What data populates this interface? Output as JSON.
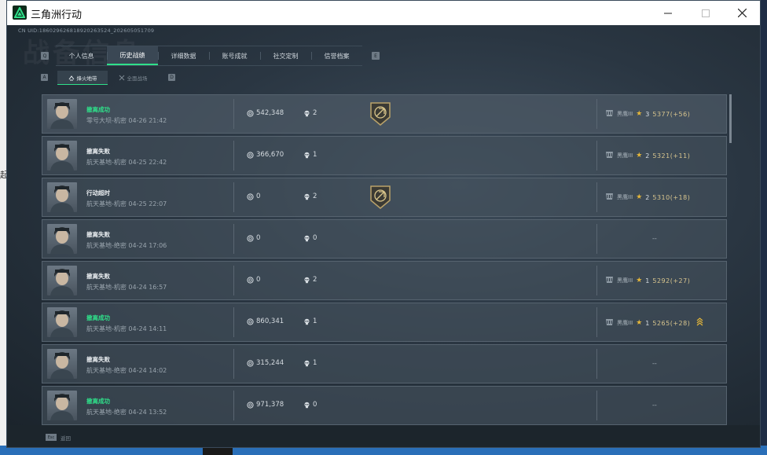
{
  "window": {
    "title": "三角洲行动"
  },
  "header": {
    "uid": "CN UID:18602962681892026352​4_2026050517​09",
    "watermark": "战备信息"
  },
  "tabs": {
    "left_key": "Q",
    "right_key": "E",
    "items": [
      {
        "label": "个人信息",
        "active": false
      },
      {
        "label": "历史战绩",
        "active": true
      },
      {
        "label": "详细数据",
        "active": false
      },
      {
        "label": "账号成就",
        "active": false
      },
      {
        "label": "社交定制",
        "active": false
      },
      {
        "label": "信誉档案",
        "active": false
      }
    ]
  },
  "subtabs": {
    "left_key": "A",
    "right_key": "D",
    "items": [
      {
        "label": "烽火地带",
        "icon": "fire-zone-icon",
        "active": true
      },
      {
        "label": "全面战场",
        "icon": "battlefield-icon",
        "active": false
      }
    ]
  },
  "records": [
    {
      "status": "撤离成功",
      "success": true,
      "mapinfo": "零号大坝-机密 04-26 21:42",
      "coins": "542,348",
      "kills": "2",
      "badge": true,
      "rank": {
        "name": "黑鹰III",
        "stars": "3",
        "score": "5377(+56)"
      },
      "chevron": false
    },
    {
      "status": "撤离失败",
      "success": false,
      "mapinfo": "航天基地-机密 04-25 22:42",
      "coins": "366,670",
      "kills": "1",
      "badge": false,
      "rank": {
        "name": "黑鹰III",
        "stars": "2",
        "score": "5321(+11)"
      },
      "chevron": false
    },
    {
      "status": "行动超时",
      "success": false,
      "mapinfo": "航天基地-机密 04-25 22:07",
      "coins": "0",
      "kills": "2",
      "badge": true,
      "rank": {
        "name": "黑鹰III",
        "stars": "2",
        "score": "5310(+18)"
      },
      "chevron": false
    },
    {
      "status": "撤离失败",
      "success": false,
      "mapinfo": "航天基地-绝密 04-24 17:06",
      "coins": "0",
      "kills": "0",
      "badge": false,
      "rank": null,
      "chevron": false
    },
    {
      "status": "撤离失败",
      "success": false,
      "mapinfo": "航天基地-机密 04-24 16:57",
      "coins": "0",
      "kills": "2",
      "badge": false,
      "rank": {
        "name": "黑鹰III",
        "stars": "1",
        "score": "5292(+27)"
      },
      "chevron": false
    },
    {
      "status": "撤离成功",
      "success": true,
      "mapinfo": "航天基地-机密 04-24 14:11",
      "coins": "860,341",
      "kills": "1",
      "badge": false,
      "rank": {
        "name": "黑鹰III",
        "stars": "1",
        "score": "5265(+28)"
      },
      "chevron": true
    },
    {
      "status": "撤离失败",
      "success": false,
      "mapinfo": "航天基地-绝密 04-24 14:02",
      "coins": "315,244",
      "kills": "1",
      "badge": false,
      "rank": null,
      "chevron": false
    },
    {
      "status": "撤离成功",
      "success": true,
      "mapinfo": "航天基地-绝密 04-24 13:52",
      "coins": "971,378",
      "kills": "0",
      "badge": false,
      "rank": null,
      "chevron": false
    }
  ],
  "empty_rank": "--",
  "footer": {
    "esc_key": "Esc",
    "back_label": "返回"
  },
  "colors": {
    "accent": "#2fe08a",
    "gold": "#e3b53a"
  },
  "desktop": {
    "left_fragment": "起"
  }
}
